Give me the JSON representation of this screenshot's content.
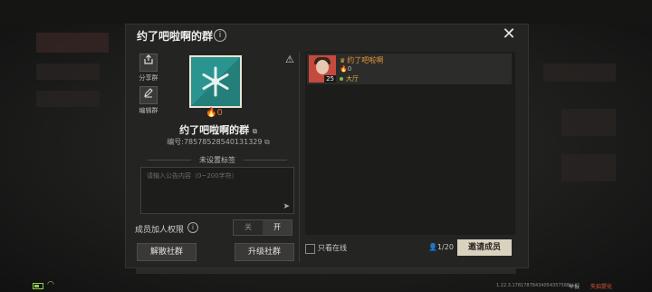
{
  "dialog": {
    "title": "约了吧啦啊的群",
    "info_icon": "i",
    "close_icon": "✕"
  },
  "left": {
    "share_label": "分享群",
    "edit_label": "编辑群",
    "heat_value": "0",
    "group_name": "约了吧啦啊的群",
    "group_id": "编号:78578528540131329",
    "warn_icon": "⚠",
    "tag_heading": "未设置标签",
    "notice_placeholder": "请输入公告内容（0~200字符）",
    "permission_label": "成员加人权限",
    "permission_info": "i",
    "toggle_off": "关",
    "toggle_on": "开",
    "dissolve_button": "解散社群",
    "upgrade_button": "升级社群"
  },
  "members": {
    "items": [
      {
        "name": "约了吧啦啊",
        "level": "25",
        "heat": "0",
        "location": "大厅"
      }
    ],
    "only_online_label": "只看在线",
    "count": "1/20",
    "invite_button": "邀请成员"
  },
  "status_bar": {
    "version": "1.22.3.17817878434054357588",
    "report": "举报",
    "feedback": "失招提化"
  },
  "colors": {
    "accent_teal": "#2a9590",
    "heat_orange": "#e56a3c",
    "member_gold": "#e89a32",
    "invite_bg": "#d9d2bf"
  }
}
